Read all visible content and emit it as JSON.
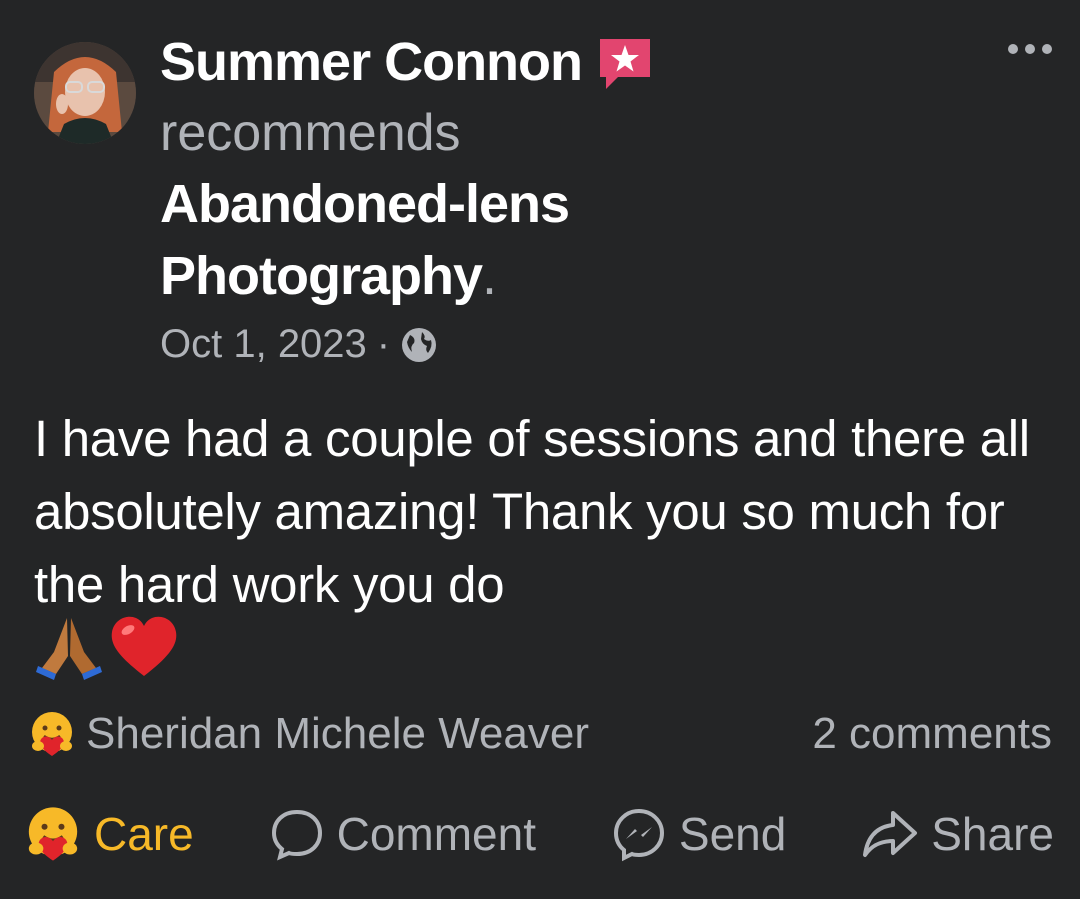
{
  "post": {
    "author_name": "Summer Connon",
    "action_text": "recommends",
    "page_name": "Abandoned-lens Photography",
    "page_name_suffix": ".",
    "date": "Oct 1, 2023",
    "separator": "·",
    "body": "I have had a couple of sessions and there all absolutely amazing! Thank you so much for the hard work you do",
    "emoji_text": "🙏❤️"
  },
  "reactions": {
    "reactor_name": "Sheridan Michele Weaver",
    "comments_label": "2 comments"
  },
  "actions": {
    "care_label": "Care",
    "comment_label": "Comment",
    "send_label": "Send",
    "share_label": "Share"
  },
  "icons": {
    "more": "more-options-icon",
    "audience": "globe-icon",
    "badge": "recommend-badge-icon",
    "care": "care-reaction-icon",
    "comment": "comment-icon",
    "send": "messenger-send-icon",
    "share": "share-icon"
  },
  "colors": {
    "background": "#242526",
    "primary_text": "#ffffff",
    "secondary_text": "#b0b3b8",
    "care_accent": "#f7b928",
    "badge_pink": "#e2456f"
  }
}
